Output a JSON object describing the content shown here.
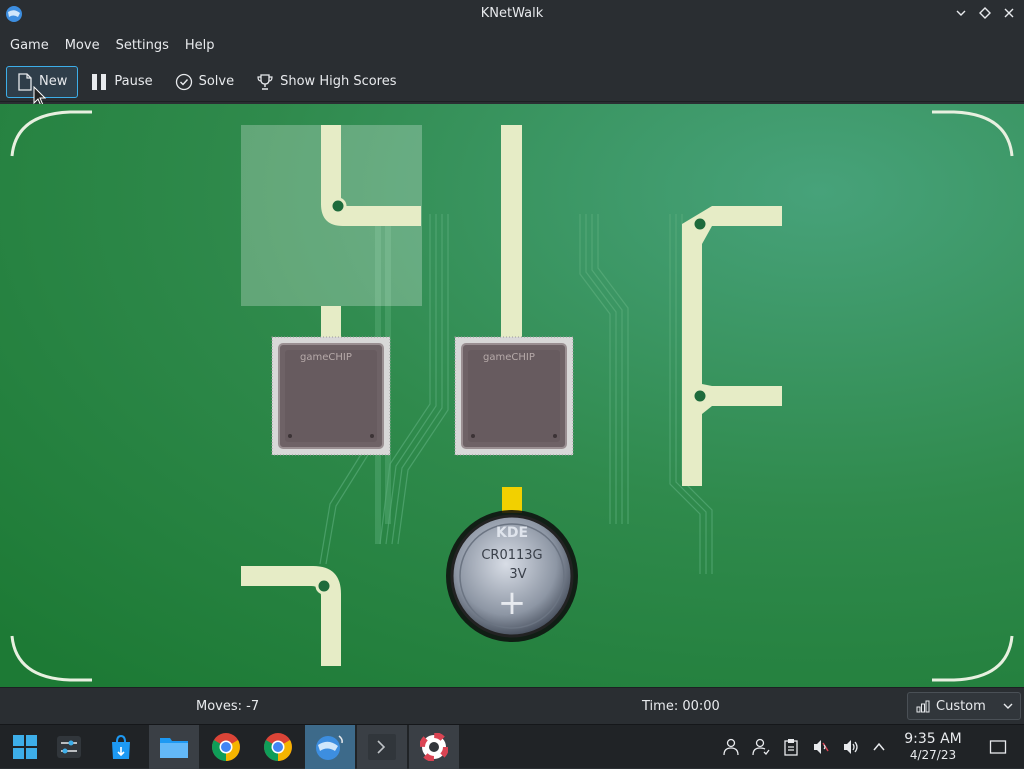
{
  "window": {
    "title": "KNetWalk"
  },
  "menu": {
    "items": [
      "Game",
      "Move",
      "Settings",
      "Help"
    ]
  },
  "toolbar": {
    "new_label": "New",
    "pause_label": "Pause",
    "solve_label": "Solve",
    "highscores_label": "Show High Scores"
  },
  "board": {
    "chip1_label": "gameCHIP",
    "chip2_label": "gameCHIP",
    "battery_brand": "KDE",
    "battery_model": "CR0113G",
    "battery_voltage": "3V",
    "battery_plus": "+"
  },
  "status": {
    "moves": "Moves: -7",
    "time": "Time: 00:00",
    "difficulty": "Custom"
  },
  "taskbar": {
    "apps": [
      "start-menu",
      "system-settings",
      "discover-store",
      "file-manager",
      "chrome",
      "chrome",
      "knetwalk",
      "konsole",
      "help-center"
    ],
    "clock_time": "9:35 AM",
    "clock_date": "4/27/23"
  },
  "colors": {
    "board_green": "#2f8a4c",
    "wire": "#e6ecc6",
    "accent": "#3daee9"
  }
}
